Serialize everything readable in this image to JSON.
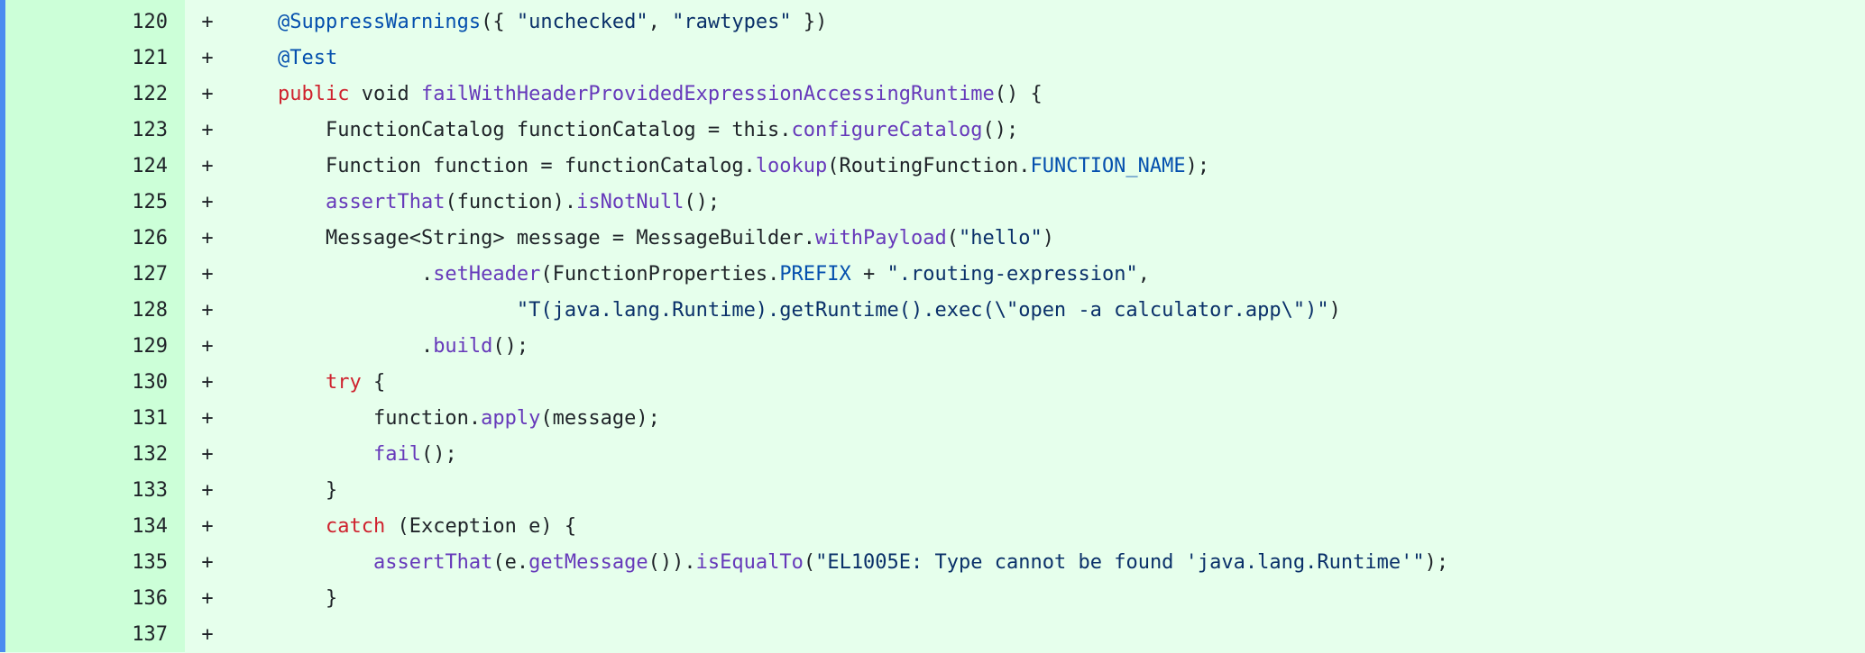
{
  "colors": {
    "added_line_bg": "#e6ffec",
    "gutter_bg": "#ccffd8",
    "left_accent": "#4a8cf0",
    "keyword": "#cf222e",
    "function": "#6639ba",
    "annotation_constant": "#0550ae",
    "string": "#0a3069",
    "plain": "#1f2328"
  },
  "lines": [
    {
      "num": "120",
      "marker": "+",
      "segments": [
        {
          "t": "an",
          "text": "@SuppressWarnings"
        },
        {
          "t": "pl",
          "text": "({ "
        },
        {
          "t": "st",
          "text": "\"unchecked\""
        },
        {
          "t": "pl",
          "text": ", "
        },
        {
          "t": "st",
          "text": "\"rawtypes\""
        },
        {
          "t": "pl",
          "text": " })"
        }
      ]
    },
    {
      "num": "121",
      "marker": "+",
      "segments": [
        {
          "t": "an",
          "text": "@Test"
        }
      ]
    },
    {
      "num": "122",
      "marker": "+",
      "segments": [
        {
          "t": "kw",
          "text": "public"
        },
        {
          "t": "pl",
          "text": " void "
        },
        {
          "t": "fn",
          "text": "failWithHeaderProvidedExpressionAccessingRuntime"
        },
        {
          "t": "pl",
          "text": "() {"
        }
      ]
    },
    {
      "num": "123",
      "marker": "+",
      "segments": [
        {
          "t": "pl",
          "text": "    FunctionCatalog functionCatalog = this."
        },
        {
          "t": "fn",
          "text": "configureCatalog"
        },
        {
          "t": "pl",
          "text": "();"
        }
      ]
    },
    {
      "num": "124",
      "marker": "+",
      "segments": [
        {
          "t": "pl",
          "text": "    Function function = functionCatalog."
        },
        {
          "t": "fn",
          "text": "lookup"
        },
        {
          "t": "pl",
          "text": "(RoutingFunction."
        },
        {
          "t": "cn",
          "text": "FUNCTION_NAME"
        },
        {
          "t": "pl",
          "text": ");"
        }
      ]
    },
    {
      "num": "125",
      "marker": "+",
      "segments": [
        {
          "t": "pl",
          "text": "    "
        },
        {
          "t": "fn",
          "text": "assertThat"
        },
        {
          "t": "pl",
          "text": "(function)."
        },
        {
          "t": "fn",
          "text": "isNotNull"
        },
        {
          "t": "pl",
          "text": "();"
        }
      ]
    },
    {
      "num": "126",
      "marker": "+",
      "segments": [
        {
          "t": "pl",
          "text": "    Message<String> message = MessageBuilder."
        },
        {
          "t": "fn",
          "text": "withPayload"
        },
        {
          "t": "pl",
          "text": "("
        },
        {
          "t": "st",
          "text": "\"hello\""
        },
        {
          "t": "pl",
          "text": ")"
        }
      ]
    },
    {
      "num": "127",
      "marker": "+",
      "segments": [
        {
          "t": "pl",
          "text": "            ."
        },
        {
          "t": "fn",
          "text": "setHeader"
        },
        {
          "t": "pl",
          "text": "(FunctionProperties."
        },
        {
          "t": "cn",
          "text": "PREFIX"
        },
        {
          "t": "pl",
          "text": " + "
        },
        {
          "t": "st",
          "text": "\".routing-expression\""
        },
        {
          "t": "pl",
          "text": ","
        }
      ]
    },
    {
      "num": "128",
      "marker": "+",
      "segments": [
        {
          "t": "pl",
          "text": "                    "
        },
        {
          "t": "st",
          "text": "\"T(java.lang.Runtime).getRuntime().exec(\\\"open -a calculator.app\\\")\""
        },
        {
          "t": "pl",
          "text": ")"
        }
      ]
    },
    {
      "num": "129",
      "marker": "+",
      "segments": [
        {
          "t": "pl",
          "text": "            ."
        },
        {
          "t": "fn",
          "text": "build"
        },
        {
          "t": "pl",
          "text": "();"
        }
      ]
    },
    {
      "num": "130",
      "marker": "+",
      "segments": [
        {
          "t": "pl",
          "text": "    "
        },
        {
          "t": "kw",
          "text": "try"
        },
        {
          "t": "pl",
          "text": " {"
        }
      ]
    },
    {
      "num": "131",
      "marker": "+",
      "segments": [
        {
          "t": "pl",
          "text": "        function."
        },
        {
          "t": "fn",
          "text": "apply"
        },
        {
          "t": "pl",
          "text": "(message);"
        }
      ]
    },
    {
      "num": "132",
      "marker": "+",
      "segments": [
        {
          "t": "pl",
          "text": "        "
        },
        {
          "t": "fn",
          "text": "fail"
        },
        {
          "t": "pl",
          "text": "();"
        }
      ]
    },
    {
      "num": "133",
      "marker": "+",
      "segments": [
        {
          "t": "pl",
          "text": "    }"
        }
      ]
    },
    {
      "num": "134",
      "marker": "+",
      "segments": [
        {
          "t": "pl",
          "text": "    "
        },
        {
          "t": "kw",
          "text": "catch"
        },
        {
          "t": "pl",
          "text": " (Exception e) {"
        }
      ]
    },
    {
      "num": "135",
      "marker": "+",
      "segments": [
        {
          "t": "pl",
          "text": "        "
        },
        {
          "t": "fn",
          "text": "assertThat"
        },
        {
          "t": "pl",
          "text": "(e."
        },
        {
          "t": "fn",
          "text": "getMessage"
        },
        {
          "t": "pl",
          "text": "())."
        },
        {
          "t": "fn",
          "text": "isEqualTo"
        },
        {
          "t": "pl",
          "text": "("
        },
        {
          "t": "st",
          "text": "\"EL1005E: Type cannot be found 'java.lang.Runtime'\""
        },
        {
          "t": "pl",
          "text": ");"
        }
      ]
    },
    {
      "num": "136",
      "marker": "+",
      "segments": [
        {
          "t": "pl",
          "text": "    }"
        }
      ]
    },
    {
      "num": "137",
      "marker": "+",
      "segments": []
    }
  ]
}
